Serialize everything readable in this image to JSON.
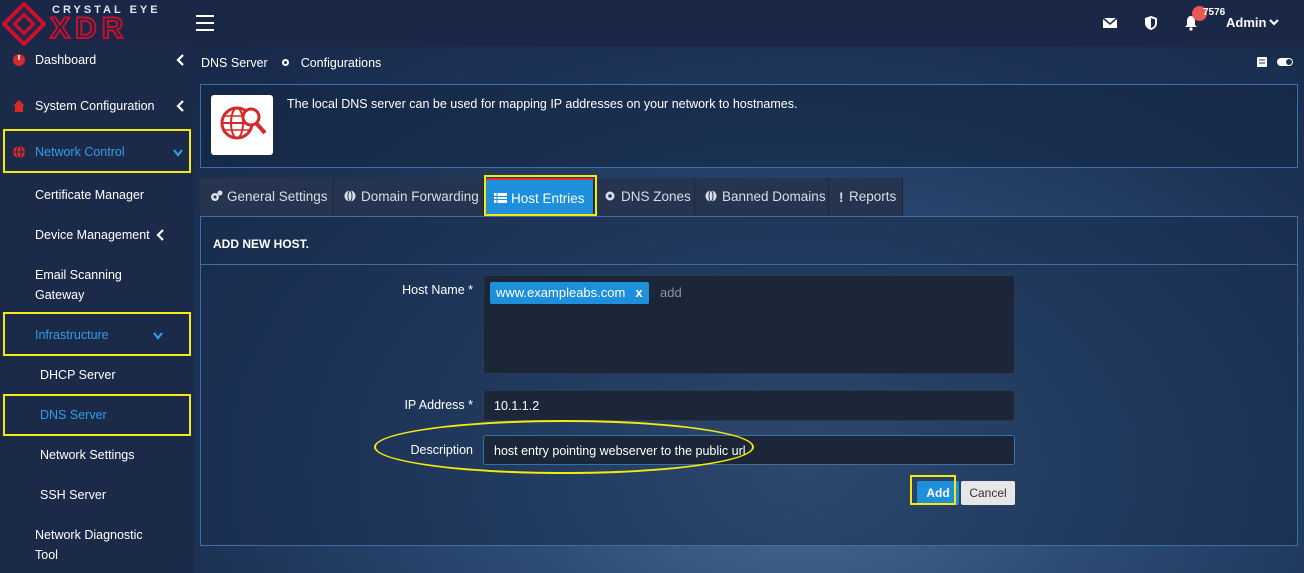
{
  "brand": {
    "top_text": "CRYSTAL EYE",
    "main_text": "XDR",
    "accent_color": "#c8102e"
  },
  "topbar": {
    "notification_badge": "7576",
    "user_label": "Admin",
    "icons": [
      "mail-icon",
      "shield-icon",
      "bell-icon",
      "chevron-down-icon"
    ]
  },
  "sidebar": {
    "items": [
      {
        "label": "Dashboard",
        "icon": "dashboard-icon"
      },
      {
        "label": "System Configuration",
        "icon": "home-icon"
      },
      {
        "label": "Network Control",
        "icon": "globe-icon",
        "active": true
      },
      {
        "label": "Certificate Manager"
      },
      {
        "label": "Device Management"
      },
      {
        "label": "Email Scanning Gateway",
        "line1": "Email Scanning",
        "line2": "Gateway"
      },
      {
        "label": "Infrastructure",
        "active": true
      },
      {
        "label": "DHCP Server"
      },
      {
        "label": "DNS Server",
        "active": true
      },
      {
        "label": "Network Settings"
      },
      {
        "label": "SSH Server"
      },
      {
        "label": "Network Diagnostic Tool",
        "line1": "Network Diagnostic",
        "line2": "Tool"
      }
    ],
    "highlight_color": "#f5e90f"
  },
  "breadcrumb": {
    "section": "DNS Server",
    "page": "Configurations"
  },
  "info": {
    "text": "The local DNS server can be used for mapping IP addresses on your network to hostnames."
  },
  "tabs": [
    {
      "label": "General Settings",
      "icon": "cogs-icon"
    },
    {
      "label": "Domain Forwarding",
      "icon": "globe-icon"
    },
    {
      "label": "Host Entries",
      "icon": "list-icon",
      "active": true
    },
    {
      "label": "DNS Zones",
      "icon": "gear-icon"
    },
    {
      "label": "Banned Domains",
      "icon": "globe-icon"
    },
    {
      "label": "Reports",
      "icon": "exclamation-icon"
    }
  ],
  "form": {
    "heading": "ADD NEW HOST.",
    "host_name_label": "Host Name *",
    "host_tag": "www.exampleabs.com",
    "host_tag_remove": "x",
    "host_placeholder": "add",
    "ip_label": "IP Address *",
    "ip_value": "10.1.1.2",
    "description_label": "Description",
    "description_value": "host entry pointing webserver to the public url",
    "add_button": "Add",
    "cancel_button": "Cancel"
  },
  "colors": {
    "primary": "#1e8fdb",
    "highlight": "#f5e90f",
    "badge": "#e8584c"
  }
}
